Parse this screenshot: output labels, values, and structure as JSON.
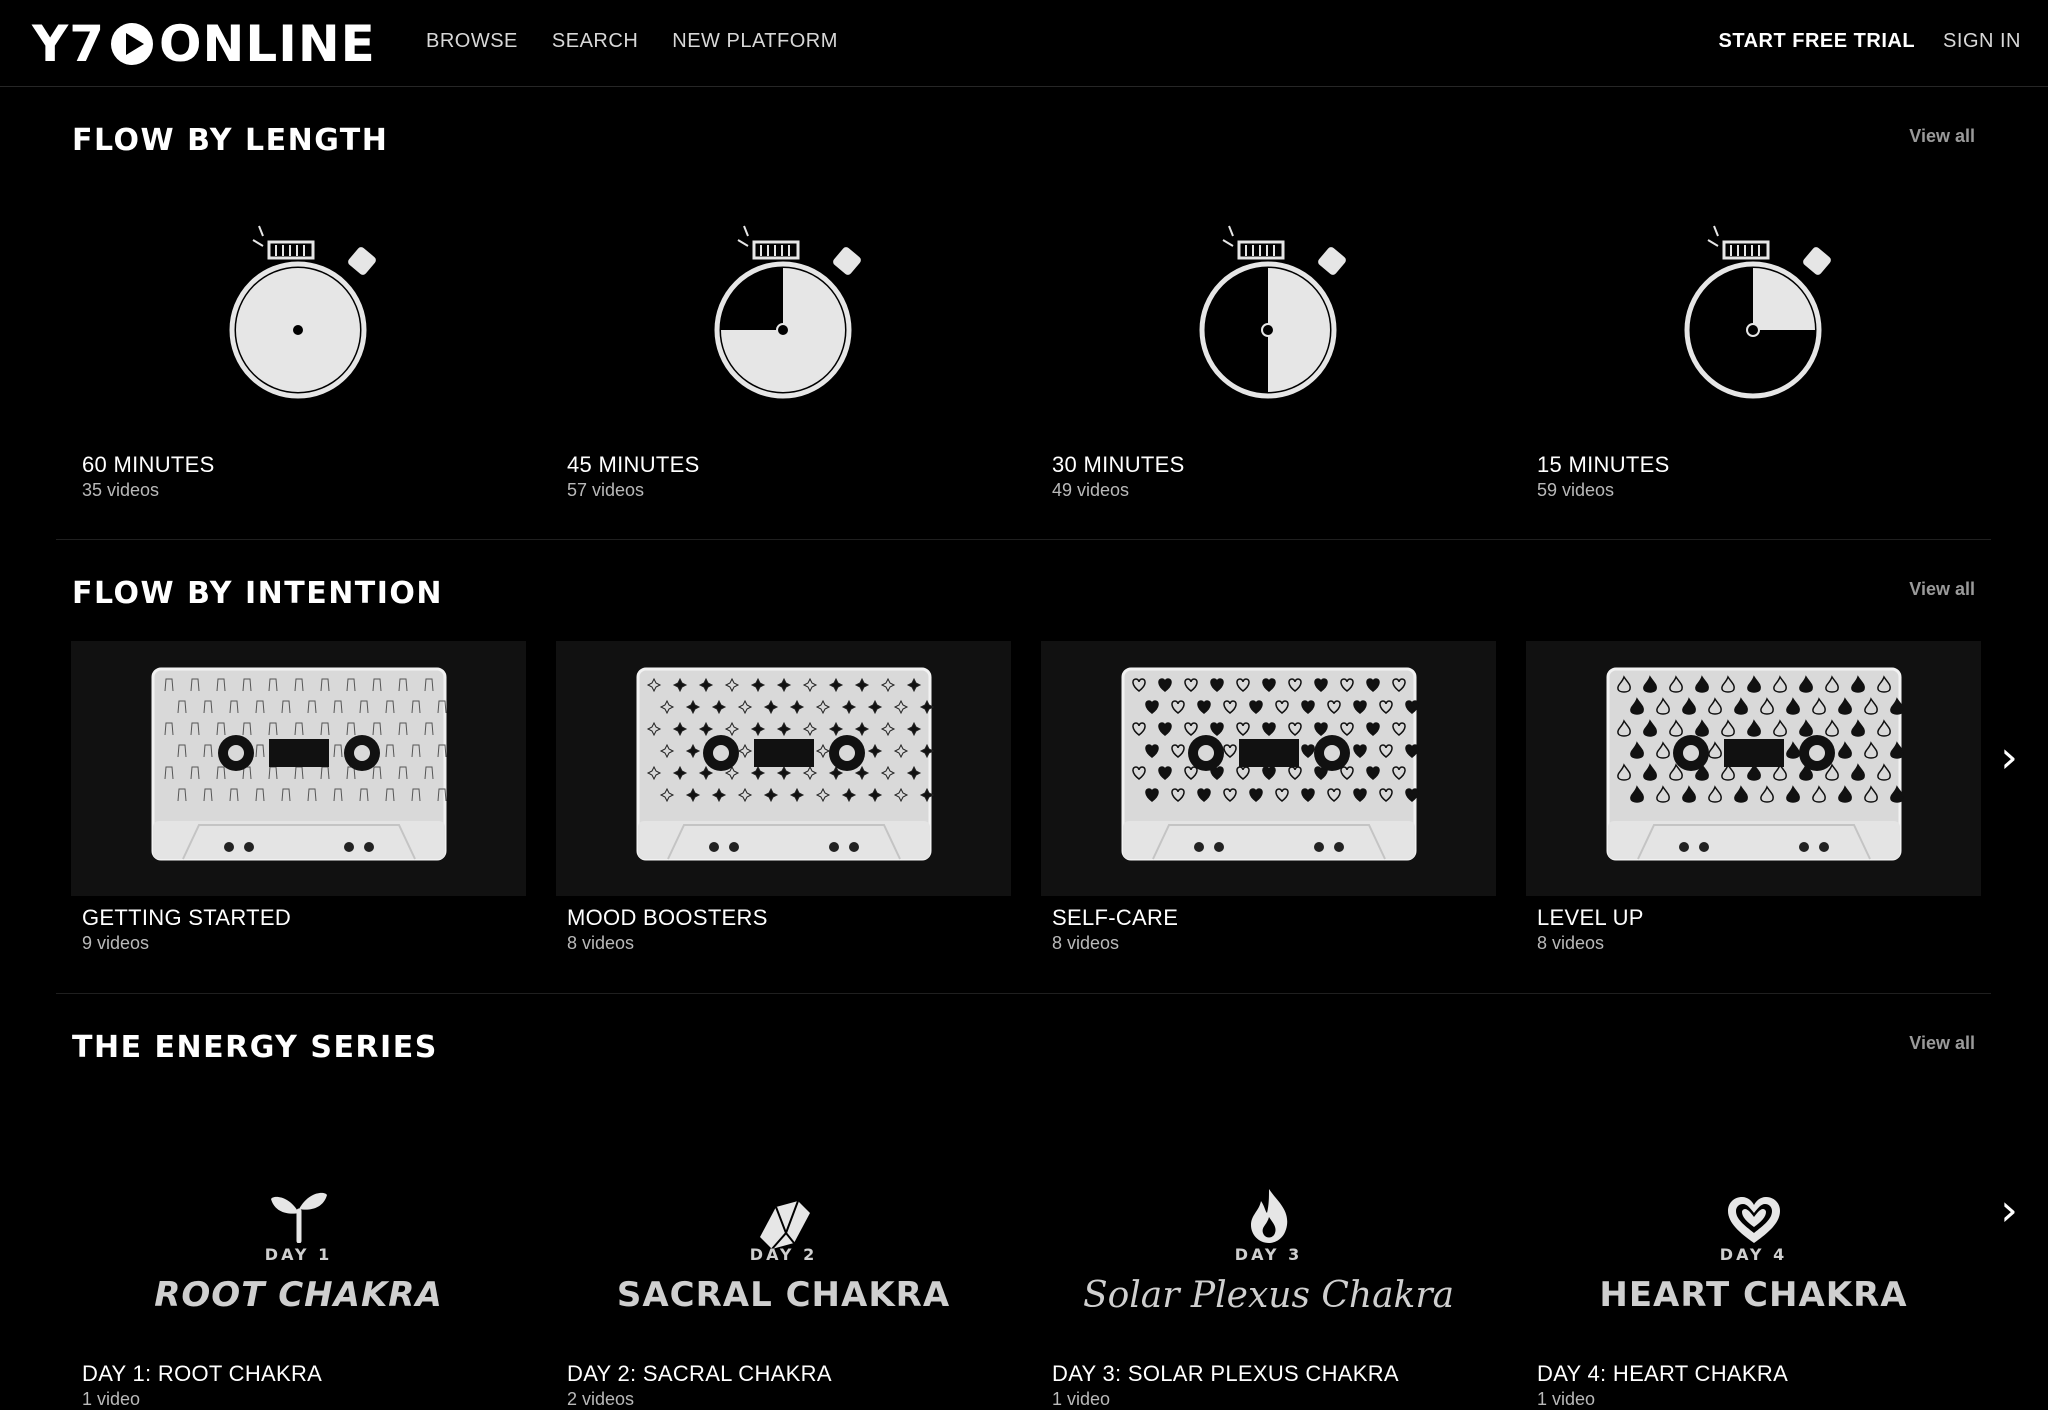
{
  "header": {
    "logo": {
      "left": "Y7",
      "right": "ONLINE"
    },
    "nav": [
      "BROWSE",
      "SEARCH",
      "NEW PLATFORM"
    ],
    "trial_label": "START FREE TRIAL",
    "signin_label": "SIGN IN"
  },
  "sections": {
    "length": {
      "title": "FLOW BY LENGTH",
      "view_all": "View all",
      "items": [
        {
          "title": "60 MINUTES",
          "count": "35 videos",
          "fill": 1.0
        },
        {
          "title": "45 MINUTES",
          "count": "57 videos",
          "fill": 0.75
        },
        {
          "title": "30 MINUTES",
          "count": "49 videos",
          "fill": 0.5
        },
        {
          "title": "15 MINUTES",
          "count": "59 videos",
          "fill": 0.25
        }
      ]
    },
    "intention": {
      "title": "FLOW BY INTENTION",
      "view_all": "View all",
      "items": [
        {
          "title": "GETTING STARTED",
          "count": "9 videos",
          "pattern": "hands"
        },
        {
          "title": "MOOD BOOSTERS",
          "count": "8 videos",
          "pattern": "stars"
        },
        {
          "title": "SELF-CARE",
          "count": "8 videos",
          "pattern": "hearts"
        },
        {
          "title": "LEVEL UP",
          "count": "8 videos",
          "pattern": "flames"
        }
      ]
    },
    "energy": {
      "title": "THE ENERGY SERIES",
      "view_all": "View all",
      "items": [
        {
          "day": "DAY 1",
          "name": "ROOT CHAKRA",
          "title": "DAY 1: ROOT CHAKRA",
          "count": "1 video",
          "icon": "sprout-icon"
        },
        {
          "day": "DAY 2",
          "name": "SACRAL CHAKRA",
          "title": "DAY 2: SACRAL CHAKRA",
          "count": "2 videos",
          "icon": "crystal-icon"
        },
        {
          "day": "DAY 3",
          "name": "Solar Plexus Chakra",
          "title": "DAY 3: SOLAR PLEXUS CHAKRA",
          "count": "1 video",
          "icon": "flame-icon"
        },
        {
          "day": "DAY 4",
          "name": "HEART CHAKRA",
          "title": "DAY 4: HEART CHAKRA",
          "count": "1 video",
          "icon": "heart-icon"
        }
      ]
    }
  },
  "colors": {
    "background": "#000000",
    "text": "#ffffff",
    "muted": "#b9b9b9",
    "divider": "#1f1f1f"
  }
}
